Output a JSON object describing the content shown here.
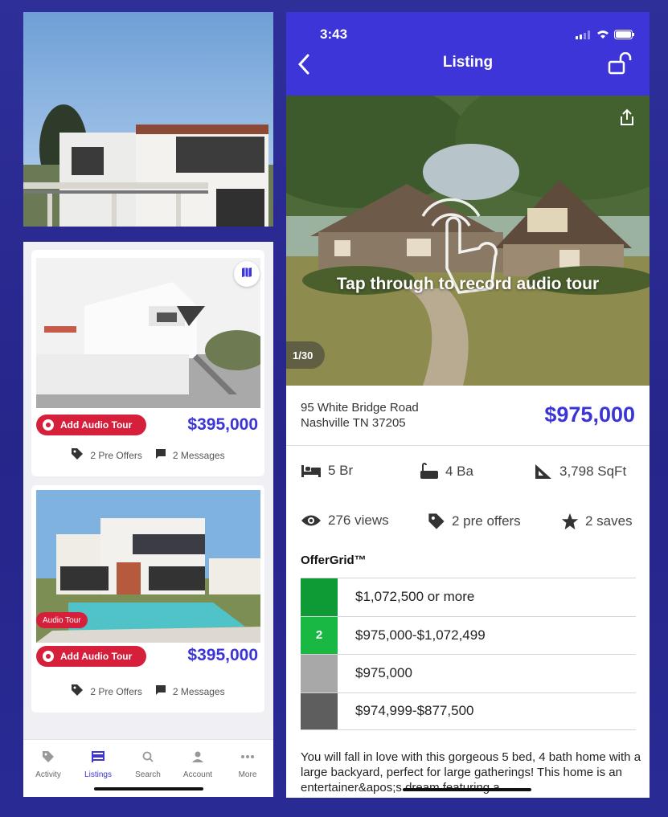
{
  "left": {
    "cards": [
      {
        "audio_label": "Add Audio Tour",
        "price": "$395,000",
        "offers": "2 Pre Offers",
        "messages": "2 Messages"
      },
      {
        "badge": "Audio Tour",
        "audio_label": "Add Audio Tour",
        "price": "$395,000",
        "offers": "2 Pre Offers",
        "messages": "2 Messages"
      }
    ],
    "tabs": [
      {
        "label": "Activity",
        "icon": "tag-icon"
      },
      {
        "label": "Listings",
        "icon": "listings-icon",
        "active": true
      },
      {
        "label": "Search",
        "icon": "search-icon"
      },
      {
        "label": "Account",
        "icon": "person-icon"
      },
      {
        "label": "More",
        "icon": "more-icon"
      }
    ]
  },
  "listing": {
    "status_time": "3:43",
    "title": "Listing",
    "tap_text": "Tap through to record audio tour",
    "photo_counter": "1/30",
    "address_line1": "95 White Bridge Road",
    "address_line2": "Nashville TN 37205",
    "price": "$975,000",
    "beds": "5 Br",
    "baths": "4 Ba",
    "sqft": "3,798 SqFt",
    "views": "276 views",
    "pre_offers": "2 pre offers",
    "saves": "2 saves",
    "offergrid_title": "OfferGrid™",
    "offergrid": [
      {
        "count": "",
        "label": "$1,072,500 or more",
        "color": "#0e9a35"
      },
      {
        "count": "2",
        "label": "$975,000-$1,072,499",
        "color": "#19b843"
      },
      {
        "count": "",
        "label": "$975,000",
        "color": "#a8a8a8"
      },
      {
        "count": "",
        "label": "$974,999-$877,500",
        "color": "#5e5e5e"
      }
    ],
    "description": "You will fall in love with this gorgeous 5 bed, 4 bath home with a large backyard, perfect for large gatherings! This home is an entertainer&apos;s dream featuring a"
  },
  "colors": {
    "brand": "#3d35d8",
    "accent_red": "#d61f3a",
    "background": "#2a2a95"
  }
}
